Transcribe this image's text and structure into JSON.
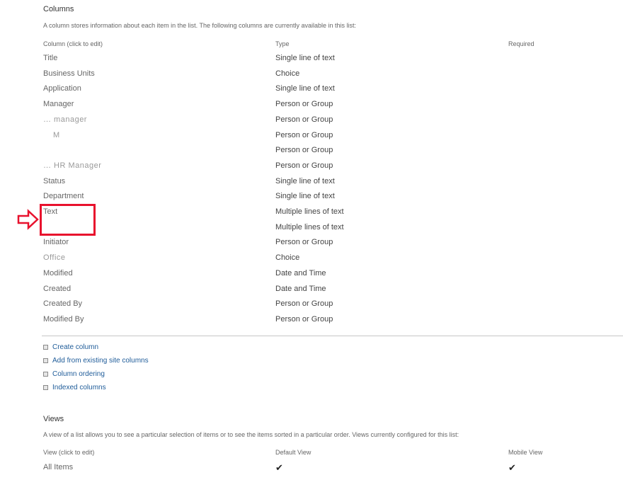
{
  "columns_section": {
    "title": "Columns",
    "description": "A column stores information about each item in the list. The following columns are currently available in this list:",
    "headers": {
      "column": "Column (click to edit)",
      "type": "Type",
      "required": "Required"
    },
    "rows": [
      {
        "name": "Title",
        "type": "Single line of text"
      },
      {
        "name": "Business Units",
        "type": "Choice"
      },
      {
        "name": "Application",
        "type": "Single line of text"
      },
      {
        "name": "Manager",
        "type": "Person or Group"
      },
      {
        "name": "… manager",
        "type": "Person or Group"
      },
      {
        "name": "M",
        "type": "Person or Group"
      },
      {
        "name": "",
        "type": "Person or Group"
      },
      {
        "name": "… HR Manager",
        "type": "Person or Group"
      },
      {
        "name": "Status",
        "type": "Single line of text"
      },
      {
        "name": "Department",
        "type": "Single line of text"
      },
      {
        "name": "Text",
        "type": "Multiple lines of text"
      },
      {
        "name": "",
        "type": "Multiple lines of text"
      },
      {
        "name": "Initiator",
        "type": "Person or Group"
      },
      {
        "name": "Office",
        "type": "Choice"
      },
      {
        "name": "Modified",
        "type": "Date and Time"
      },
      {
        "name": "Created",
        "type": "Date and Time"
      },
      {
        "name": "Created By",
        "type": "Person or Group"
      },
      {
        "name": "Modified By",
        "type": "Person or Group"
      }
    ]
  },
  "actions": [
    "Create column",
    "Add from existing site columns",
    "Column ordering",
    "Indexed columns"
  ],
  "views_section": {
    "title": "Views",
    "description": "A view of a list allows you to see a particular selection of items or to see the items sorted in a particular order. Views currently configured for this list:",
    "headers": {
      "view": "View (click to edit)",
      "default": "Default View",
      "mobile": "Mobile View"
    },
    "rows": [
      {
        "name": "All Items",
        "default_check": "✔",
        "mobile_check": "✔"
      }
    ]
  },
  "annotation": {
    "color": "#e8112d",
    "arrow": "right-arrow-icon"
  }
}
